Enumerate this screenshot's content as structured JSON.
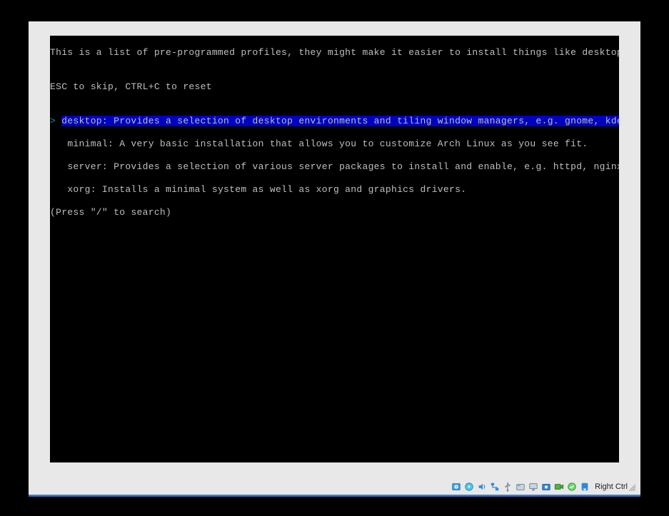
{
  "console": {
    "header": "This is a list of pre-programmed profiles, they might make it easier to install things like desktop",
    "blank": "",
    "hint": "ESC to skip, CTRL+C to reset",
    "pointer": "> ",
    "indent": "   ",
    "items": [
      {
        "name": "desktop",
        "selected": true,
        "text": "desktop: Provides a selection of desktop environments and tiling window managers, e.g. gnome, kde,"
      },
      {
        "name": "minimal",
        "selected": false,
        "text": "minimal: A very basic installation that allows you to customize Arch Linux as you see fit."
      },
      {
        "name": "server",
        "selected": false,
        "text": "server: Provides a selection of various server packages to install and enable, e.g. httpd, nginx,"
      },
      {
        "name": "xorg",
        "selected": false,
        "text": "xorg: Installs a minimal system as well as xorg and graphics drivers."
      }
    ],
    "search_hint": "(Press \"/\" to search)"
  },
  "statusbar": {
    "host_key": "Right Ctrl",
    "icons": [
      "harddisk-icon",
      "optical-disc-icon",
      "audio-icon",
      "network-icon",
      "usb-icon",
      "shared-folder-icon",
      "display-icon",
      "snapshot-icon",
      "recording-icon",
      "cpu-icon",
      "mouse-integration-icon"
    ]
  }
}
